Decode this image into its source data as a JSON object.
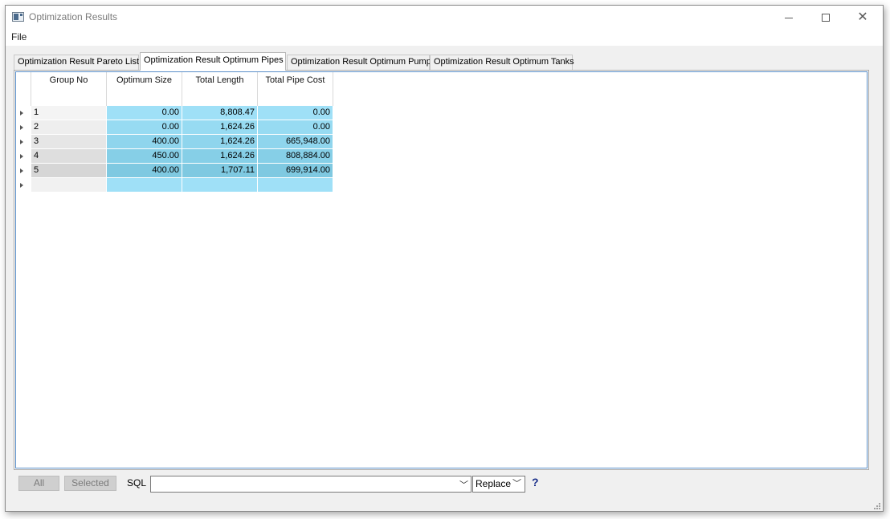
{
  "window": {
    "title": "Optimization Results"
  },
  "menu": {
    "file": "File"
  },
  "tabs": [
    {
      "label": "Optimization Result Pareto List",
      "active": false
    },
    {
      "label": "Optimization Result Optimum Pipes",
      "active": true
    },
    {
      "label": "Optimization Result Optimum Pumps",
      "active": false
    },
    {
      "label": "Optimization Result Optimum Tanks",
      "active": false
    }
  ],
  "grid": {
    "columns": [
      "Group No",
      "Optimum Size",
      "Total Length",
      "Total Pipe Cost"
    ],
    "rows": [
      {
        "group": "1",
        "optimum_size": "0.00",
        "total_length": "8,808.47",
        "total_pipe_cost": "0.00"
      },
      {
        "group": "2",
        "optimum_size": "0.00",
        "total_length": "1,624.26",
        "total_pipe_cost": "0.00"
      },
      {
        "group": "3",
        "optimum_size": "400.00",
        "total_length": "1,624.26",
        "total_pipe_cost": "665,948.00"
      },
      {
        "group": "4",
        "optimum_size": "450.00",
        "total_length": "1,624.26",
        "total_pipe_cost": "808,884.00"
      },
      {
        "group": "5",
        "optimum_size": "400.00",
        "total_length": "1,707.11",
        "total_pipe_cost": "699,914.00"
      },
      {
        "group": "",
        "optimum_size": "",
        "total_length": "",
        "total_pipe_cost": ""
      }
    ],
    "colors": {
      "group_shades": [
        "#f4f4f4",
        "#eeeeee",
        "#e6e6e6",
        "#dedede",
        "#d6d6d6",
        "#f1f1f1"
      ],
      "value_shades": [
        "#9fe0f7",
        "#97dbf2",
        "#8fd5ed",
        "#86cfe7",
        "#7fc9e1",
        "#9fe0f7"
      ]
    }
  },
  "bottom": {
    "all_label": "All",
    "selected_label": "Selected",
    "sql_label": "SQL",
    "sql_value": "",
    "replace_label": "Replace",
    "help_label": "?"
  }
}
